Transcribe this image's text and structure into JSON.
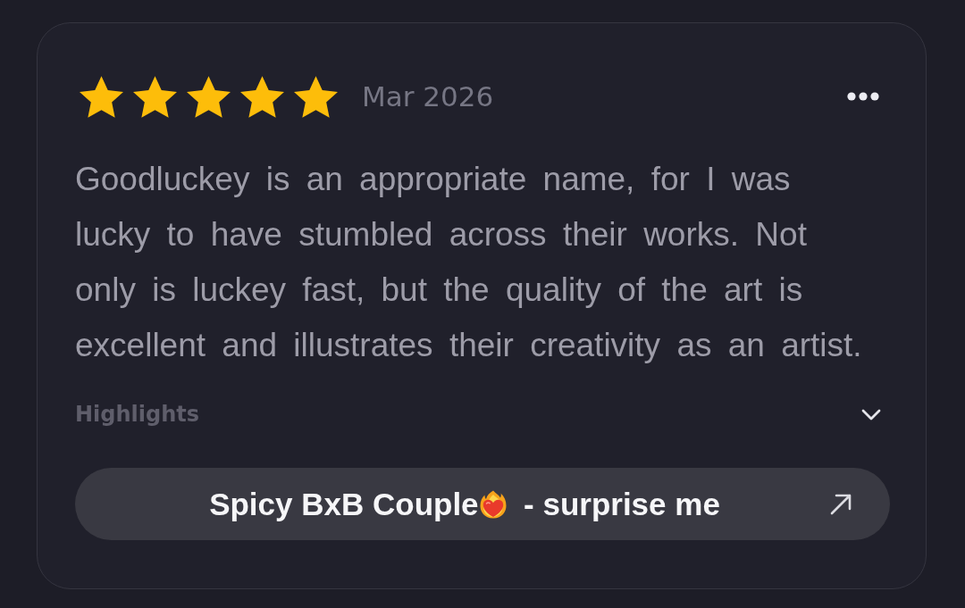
{
  "review": {
    "stars": 5,
    "date": "Mar 2026",
    "text": "Goodluckey is an appropriate name, for I was lucky to have stumbled across their works. Not only is luckey fast, but the quality of the art is excellent and illustrates their creativity as an artist.",
    "highlights": {
      "label": "Highlights",
      "expanded": false
    },
    "link_button": {
      "label_parts": [
        "Spicy BxB Couple",
        "- surprise me"
      ]
    }
  }
}
